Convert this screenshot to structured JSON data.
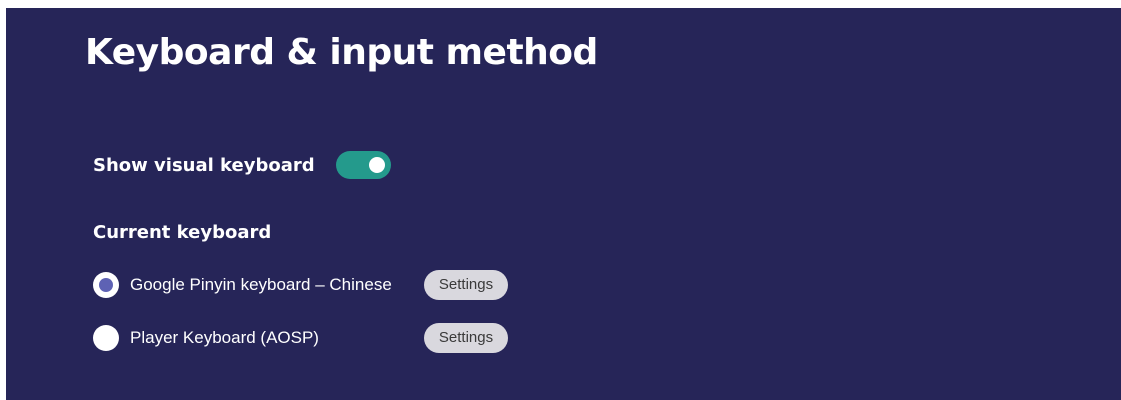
{
  "header": {
    "title": "Keyboard & input method"
  },
  "visual_keyboard": {
    "label": "Show visual keyboard",
    "enabled": true
  },
  "current_keyboard": {
    "heading": "Current keyboard",
    "options": [
      {
        "label": "Google Pinyin keyboard – Chinese",
        "selected": true,
        "settings_label": "Settings"
      },
      {
        "label": "Player Keyboard (AOSP)",
        "selected": false,
        "settings_label": "Settings"
      }
    ]
  },
  "colors": {
    "background": "#262558",
    "toggle_on": "#249a8c",
    "radio_selected_dot": "#5e62b4",
    "button_bg": "#d9d8de"
  }
}
